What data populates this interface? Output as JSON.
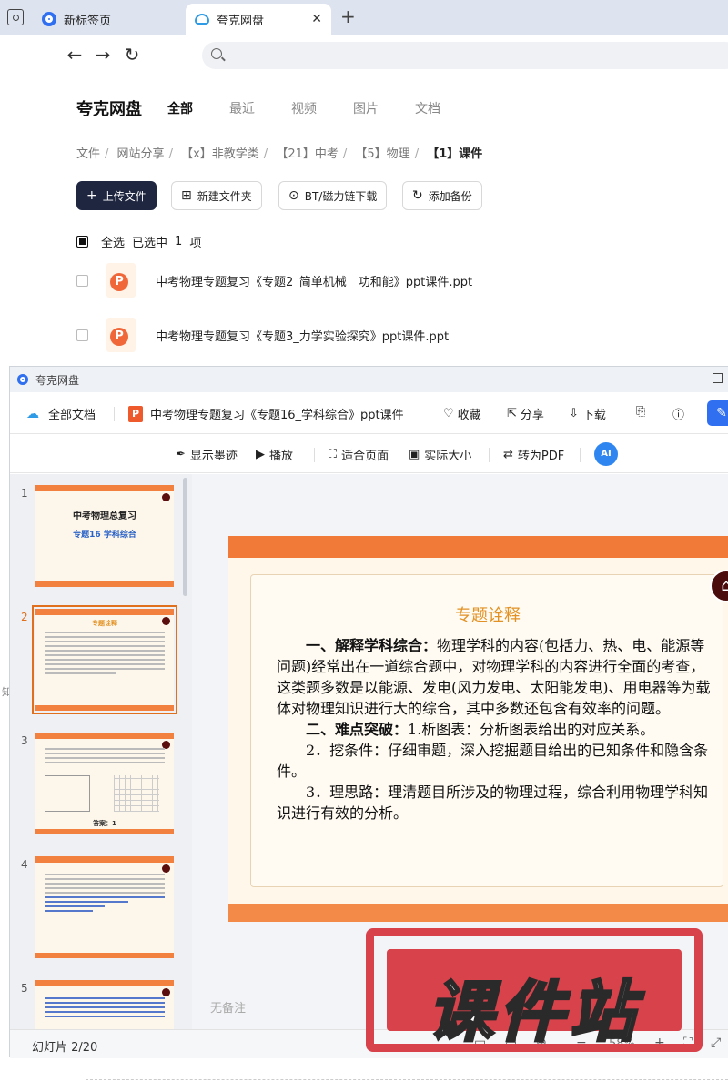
{
  "browser": {
    "tabs": [
      {
        "label": "新标签页",
        "close": ""
      },
      {
        "label": "夸克网盘",
        "close": "✕"
      }
    ],
    "new_tab": "+"
  },
  "disk": {
    "logo": "夸克网盘",
    "tabs": [
      "全部",
      "最近",
      "视频",
      "图片",
      "文档"
    ],
    "breadcrumbs": [
      "文件",
      "网站分享",
      "【x】非教学类",
      "【21】中考",
      "【5】物理",
      "【1】课件"
    ],
    "actions": {
      "upload": "上传文件",
      "new_folder": "新建文件夹",
      "bt": "BT/磁力链下载",
      "backup": "添加备份"
    },
    "selection": {
      "select_all": "全选",
      "selected": "已选中",
      "count": "1",
      "unit": "项"
    },
    "files": [
      {
        "name": "中考物理专题复习《专题2_简单机械__功和能》ppt课件.ppt"
      },
      {
        "name": "中考物理专题复习《专题3_力学实验探究》ppt课件.ppt"
      }
    ]
  },
  "viewer": {
    "window_title": "夸克网盘",
    "header": {
      "all_docs": "全部文档",
      "doc_title": "中考物理专题复习《专题16_学科综合》ppt课件",
      "favorite": "收藏",
      "share": "分享",
      "download": "下载"
    },
    "tools": {
      "ink": "显示墨迹",
      "play": "播放",
      "fit": "适合页面",
      "actual": "实际大小",
      "pdf": "转为PDF",
      "ai": "AI"
    },
    "thumbnails": [
      {
        "num": "1",
        "title": "中考物理总复习",
        "subtitle": "专题16    学科综合"
      },
      {
        "num": "2",
        "title": "专题诠释"
      },
      {
        "num": "3",
        "footer": "答案：1"
      },
      {
        "num": "4"
      },
      {
        "num": "5"
      }
    ],
    "slide": {
      "heading": "专题诠释",
      "p1_label": "一、解释学科综合：",
      "p1_text": "物理学科的内容(包括力、热、电、能源等问题)经常出在一道综合题中，对物理学科的内容进行全面的考查，这类题多数是以能源、发电(风力发电、太阳能发电)、用电器等为载体对物理知识进行大的综合，其中多数还包含有效率的问题。",
      "p2_label": "二、难点突破：",
      "p2_text": "1.析图表：分析图表给出的对应关系。",
      "p3_text": "2．挖条件：仔细审题，深入挖掘题目给出的已知条件和隐含条件。",
      "p4_text": "3．理思路：理清题目所涉及的物理过程，综合利用物理学科知识进行有效的分析。"
    },
    "note_placeholder": "无备注",
    "status": {
      "slide_counter": "幻灯片 2/20",
      "zoom": "58%"
    }
  },
  "watermark": {
    "text": "课件站"
  },
  "colors": {
    "accent": "#2f6ff0",
    "slide_orange": "#f27a39",
    "watermark_red": "#d8424b"
  }
}
